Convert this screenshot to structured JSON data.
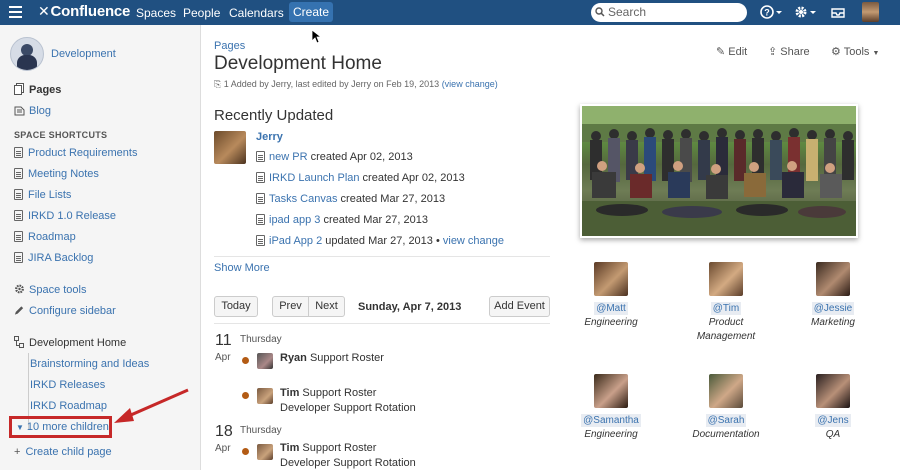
{
  "topbar": {
    "brand": "Confluence",
    "nav": [
      "Spaces",
      "People",
      "Calendars"
    ],
    "create": "Create",
    "search_placeholder": "Search"
  },
  "sidebar": {
    "space_name": "Development",
    "pages": "Pages",
    "blog": "Blog",
    "shortcuts_heading": "SPACE SHORTCUTS",
    "shortcuts": [
      "Product Requirements",
      "Meeting Notes",
      "File Lists",
      "IRKD 1.0 Release",
      "Roadmap",
      "JIRA Backlog"
    ],
    "space_tools": "Space tools",
    "configure": "Configure sidebar",
    "tree_root": "Development Home",
    "children": [
      "Brainstorming and Ideas",
      "IRKD Releases",
      "IRKD Roadmap"
    ],
    "more_children": "10 more children",
    "create_child": "Create child page"
  },
  "page": {
    "breadcrumb": "Pages",
    "title": "Development Home",
    "meta_prefix": "1  Added by Jerry, last edited by Jerry on Feb 19, 2013",
    "meta_link": "(view change)",
    "actions": [
      "Edit",
      "Share",
      "Tools"
    ]
  },
  "recently_updated": {
    "heading": "Recently Updated",
    "user": "Jerry",
    "items": [
      {
        "link": "new PR",
        "text": " created Apr 02, 2013"
      },
      {
        "link": "IRKD Launch Plan",
        "text": " created Apr 02, 2013"
      },
      {
        "link": "Tasks Canvas",
        "text": " created Mar 27, 2013"
      },
      {
        "link": "ipad app 3",
        "text": " created Mar 27, 2013"
      },
      {
        "link": "iPad App 2",
        "text": " updated Mar 27, 2013 • ",
        "extra": "view change"
      }
    ],
    "show_more": "Show More"
  },
  "calendar": {
    "today": "Today",
    "prev": "Prev",
    "next": "Next",
    "date": "Sunday, Apr 7, 2013",
    "add_event": "Add Event",
    "days": [
      {
        "num": "11",
        "month": "Apr",
        "weekday": "Thursday"
      },
      {
        "num": "18",
        "month": "Apr",
        "weekday": "Thursday"
      }
    ],
    "events": [
      {
        "name": "Ryan",
        "cal": "Support Roster",
        "sub": ""
      },
      {
        "name": "Tim",
        "cal": "Support Roster",
        "sub": "Developer Support Rotation"
      },
      {
        "name": "Tim",
        "cal": "Support Roster",
        "sub": "Developer Support Rotation"
      }
    ]
  },
  "team": [
    {
      "name": "@Matt",
      "role": "Engineering",
      "color": "#8a6a4a"
    },
    {
      "name": "@Tim",
      "role": "Product Management",
      "color": "#a07a5a"
    },
    {
      "name": "@Jessie",
      "role": "Marketing",
      "color": "#6a5040"
    },
    {
      "name": "@Samantha",
      "role": "Engineering",
      "color": "#7a5a48"
    },
    {
      "name": "@Sarah",
      "role": "Documentation",
      "color": "#9a7a5a"
    },
    {
      "name": "@Jens",
      "role": "QA",
      "color": "#5a4a3a"
    }
  ],
  "colors": {
    "header": "#205081",
    "link": "#3b73af",
    "highlight": "#c62828"
  }
}
